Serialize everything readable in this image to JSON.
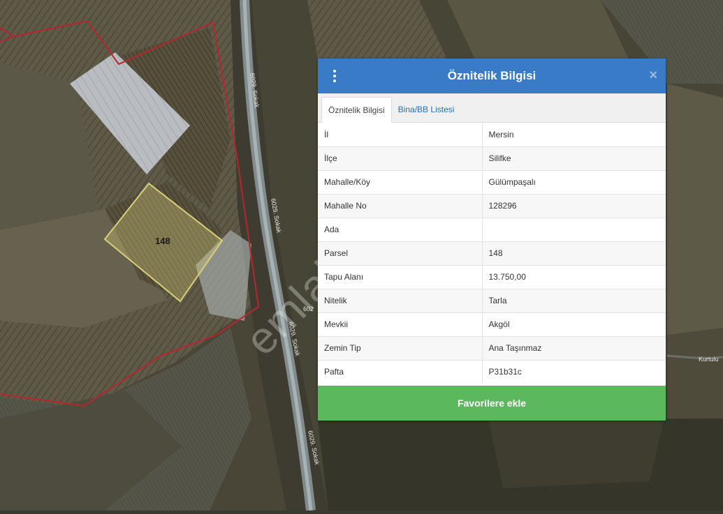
{
  "map": {
    "parcel_label": "148",
    "road_labels": [
      "6029. Sokak",
      "6029. Sokak",
      "6029. Sokak",
      "6029. Sokak",
      "602",
      "Kurtulu"
    ],
    "watermark": "emlakjet.com",
    "colors": {
      "parcel_highlight": "#d9cf7a",
      "parcel_border": "#b5272d"
    }
  },
  "popup": {
    "title": "Öznitelik Bilgisi",
    "menu_icon": "vertical-dots-icon",
    "close_label": "×",
    "tabs": [
      {
        "label": "Öznitelik Bilgisi",
        "active": true
      },
      {
        "label": "Bina/BB Listesi",
        "active": false
      }
    ],
    "rows": [
      {
        "key": "İl",
        "value": "Mersin"
      },
      {
        "key": "İlçe",
        "value": "Silifke"
      },
      {
        "key": "Mahalle/Köy",
        "value": "Gülümpaşalı"
      },
      {
        "key": "Mahalle No",
        "value": "128296"
      },
      {
        "key": "Ada",
        "value": ""
      },
      {
        "key": "Parsel",
        "value": "148"
      },
      {
        "key": "Tapu Alanı",
        "value": "13.750,00"
      },
      {
        "key": "Nitelik",
        "value": "Tarla"
      },
      {
        "key": "Mevkii",
        "value": "Akgöl"
      },
      {
        "key": "Zemin Tip",
        "value": "Ana Taşınmaz"
      },
      {
        "key": "Pafta",
        "value": "P31b31c"
      }
    ],
    "favorite_button": "Favorilere ekle",
    "colors": {
      "header": "#3a7bc8",
      "tab_link": "#2a6db5",
      "favorite": "#5cb85c"
    }
  }
}
